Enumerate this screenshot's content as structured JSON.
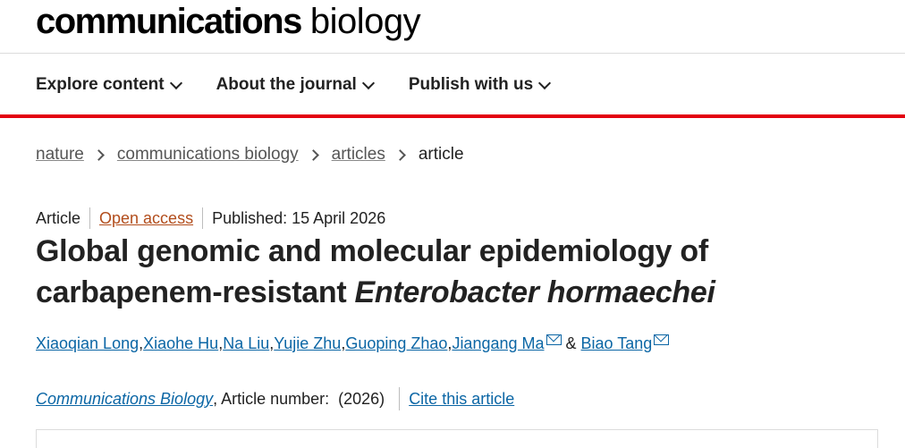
{
  "masthead": {
    "brand_bold": "communications",
    "brand_light": "biology"
  },
  "nav": {
    "explore": "Explore content",
    "about": "About the journal",
    "publish": "Publish with us"
  },
  "breadcrumb": {
    "nature": "nature",
    "journal": "communications biology",
    "articles": "articles",
    "current": "article"
  },
  "meta": {
    "type": "Article",
    "open_access": "Open access",
    "published": "Published: 15 April 2026"
  },
  "title": {
    "line1": "Global genomic and molecular epidemiology of",
    "line2_prefix": "carbapenem-resistant ",
    "line2_italic": "Enterobacter hormaechei"
  },
  "authors": {
    "a1": "Xiaoqian Long",
    "a2": "Xiaohe Hu",
    "a3": "Na Liu",
    "a4": "Yujie Zhu",
    "a5": "Guoping Zhao",
    "a6": "Jiangang Ma",
    "a7": "Biao Tang",
    "sep": ", ",
    "amp": " & "
  },
  "citation": {
    "journal": "Communications Biology",
    "article_number": ", Article number:  (2026)",
    "cite_this": "Cite this article"
  },
  "icons": {
    "mail": "mail-icon",
    "chevron": "chevron-down-icon",
    "crumb": "chevron-right-icon"
  },
  "colors": {
    "accent_red": "#e3000f",
    "link_blue": "#0b66a5",
    "open_access": "#b24d1c"
  }
}
